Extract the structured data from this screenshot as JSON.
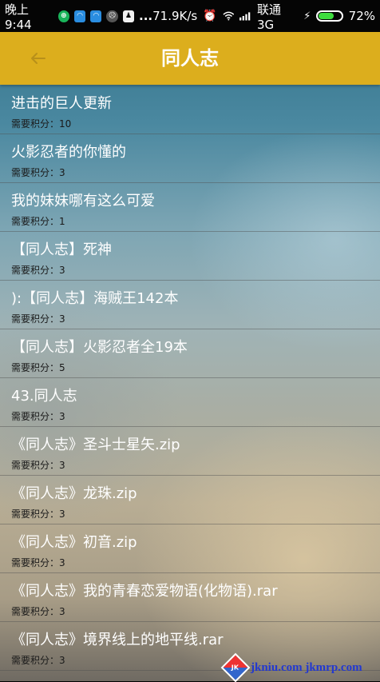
{
  "status_bar": {
    "time": "晚上9:44",
    "dots": "...",
    "net_speed": "71.9K/s",
    "carrier": "联通 3G",
    "battery": "72%",
    "battery_level": 0.72
  },
  "app_bar": {
    "back_icon": "arrow-left-icon",
    "title": "同人志"
  },
  "items": [
    {
      "name": "进击的巨人更新",
      "score": "需要积分：10"
    },
    {
      "name": "火影忍者的你懂的",
      "score": "需要积分：3"
    },
    {
      "name": "我的妹妹哪有这么可爱",
      "score": "需要积分：1"
    },
    {
      "name": "【同人志】死神",
      "score": "需要积分：3"
    },
    {
      "name": "):【同人志】海贼王142本",
      "score": "需要积分：3"
    },
    {
      "name": "【同人志】火影忍者全19本",
      "score": "需要积分：5"
    },
    {
      "name": "43.同人志",
      "score": "需要积分：3"
    },
    {
      "name": "《同人志》圣斗士星矢.zip",
      "score": "需要积分：3"
    },
    {
      "name": "《同人志》龙珠.zip",
      "score": "需要积分：3"
    },
    {
      "name": "《同人志》初音.zip",
      "score": "需要积分：3"
    },
    {
      "name": "《同人志》我的青春恋爱物语(化物语).rar",
      "score": "需要积分：3"
    },
    {
      "name": "《同人志》境界线上的地平线.rar",
      "score": "需要积分：3"
    }
  ],
  "watermark": {
    "logo_text": "JK",
    "text": "jkniu.com jkmrp.com"
  },
  "colors": {
    "app_bar": "#dcae1d",
    "status_bar": "#050505",
    "battery_fill": "#3ddc3d",
    "watermark": "#2238d0"
  }
}
